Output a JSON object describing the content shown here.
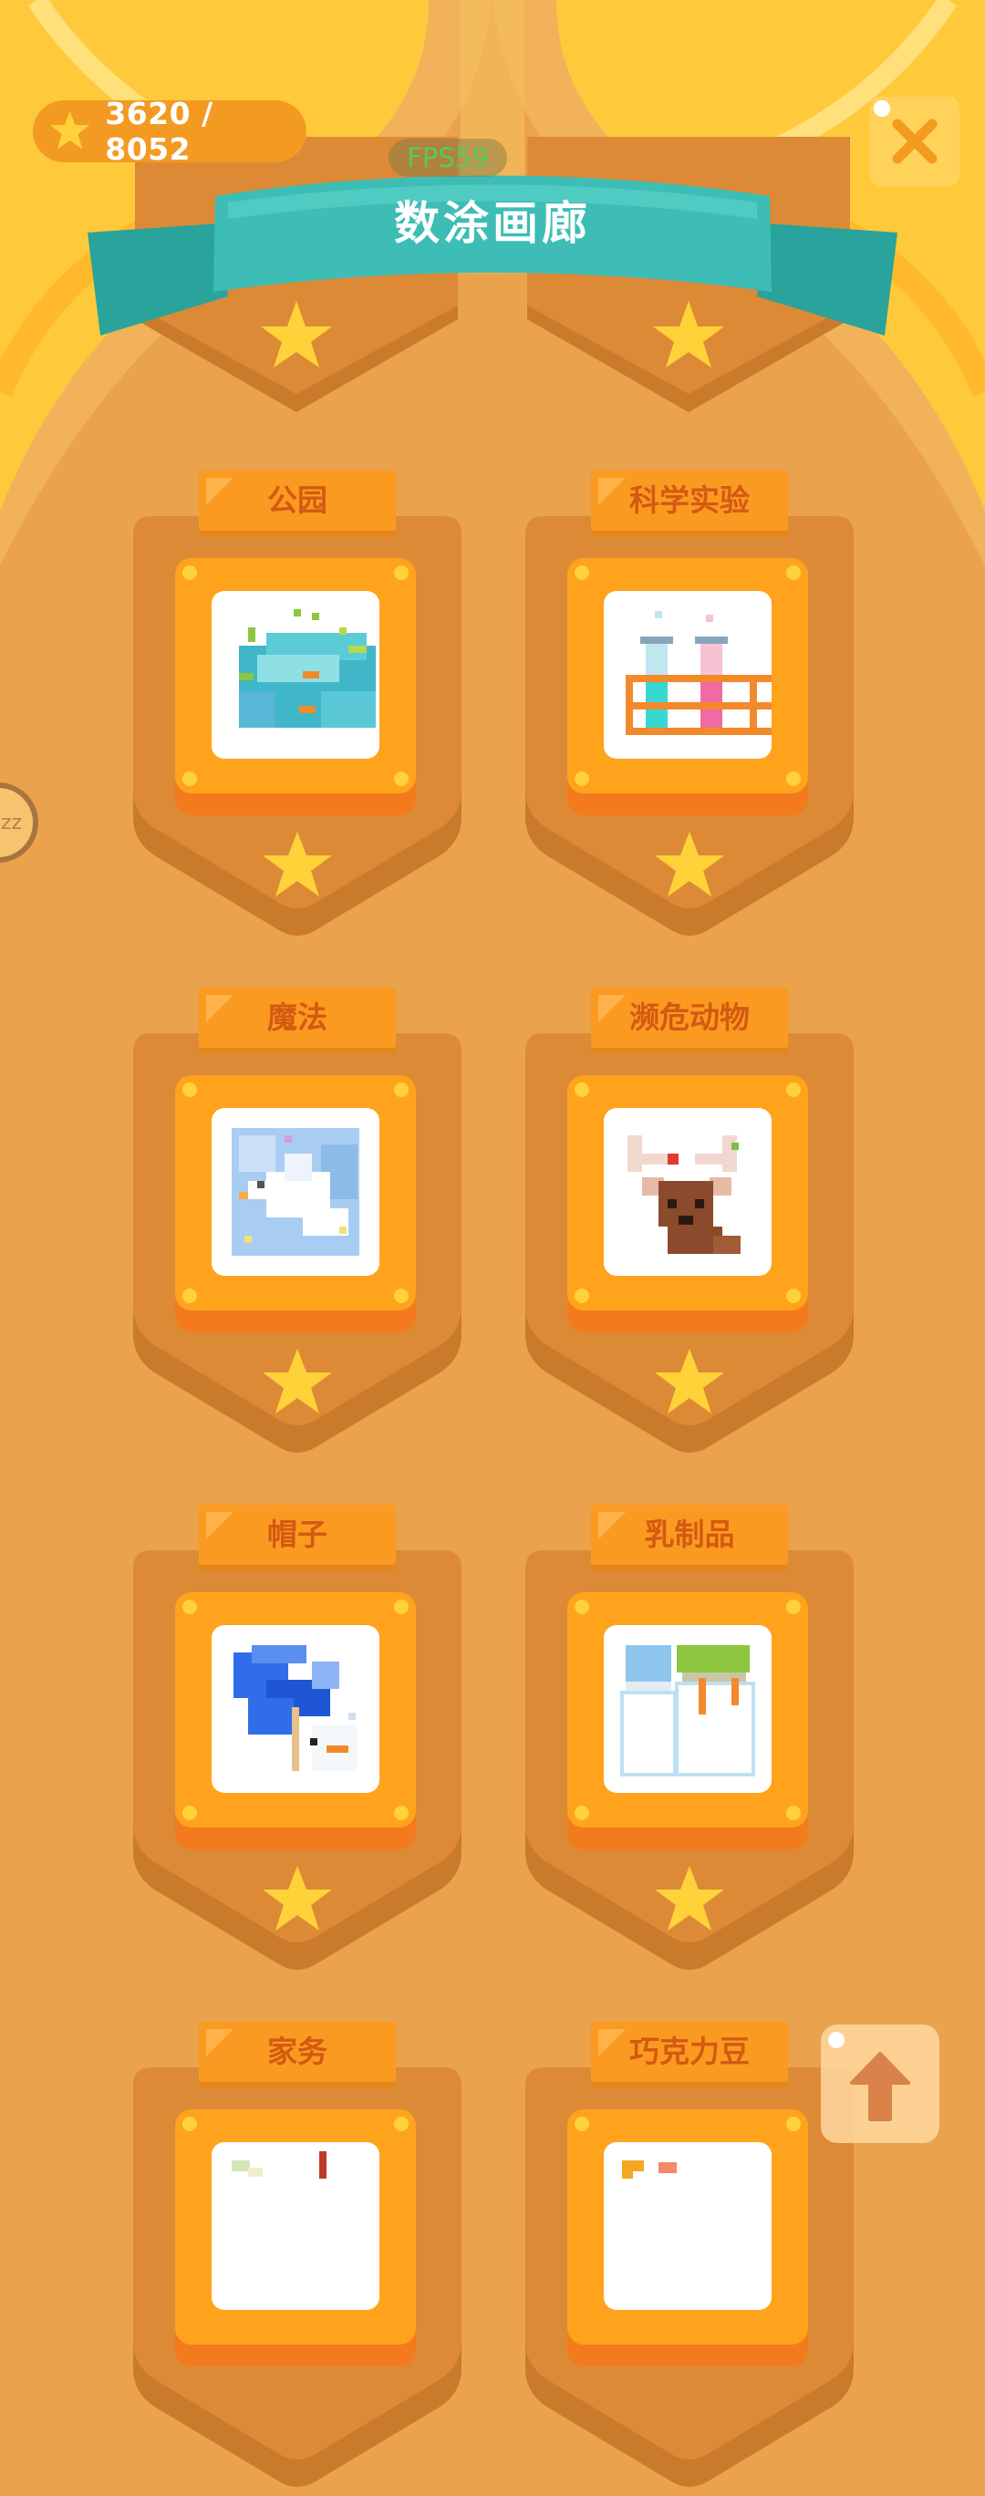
{
  "header": {
    "stars_text": "3620 / 8052",
    "title": "数涂画廊",
    "fps_text": "FPS59",
    "close_icon": "close-x-icon",
    "star_icon": "star-icon"
  },
  "colors": {
    "background": "#eba24d",
    "curtain": "#ffc93c",
    "banner": "#3dbdb5",
    "card": "#dd8a36",
    "frame": "#ffa31d",
    "tab": "#fb9a21",
    "tab_text": "#d35a12",
    "star": "#ffd23a"
  },
  "categories": [
    {
      "label": "公园",
      "art": "park"
    },
    {
      "label": "科学实验",
      "art": "science"
    },
    {
      "label": "魔法",
      "art": "magic-dove"
    },
    {
      "label": "濒危动物",
      "art": "deer"
    },
    {
      "label": "帽子",
      "art": "hat"
    },
    {
      "label": "乳制品",
      "art": "milk"
    },
    {
      "label": "家务",
      "art": "chores"
    },
    {
      "label": "巧克力豆",
      "art": "candy"
    }
  ],
  "side_handle": {
    "text": "zz"
  },
  "scroll_top": {
    "icon": "arrow-up-icon"
  }
}
